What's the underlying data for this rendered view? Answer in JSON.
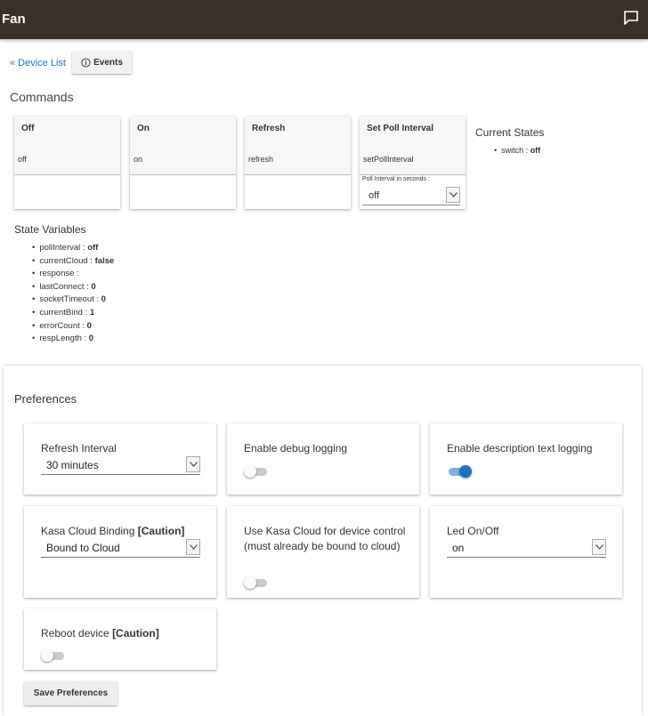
{
  "header": {
    "title": "Fan",
    "chat_icon": "chat-bubble-icon"
  },
  "nav": {
    "device_list_link": "« Device List",
    "events_button": "Events",
    "events_icon": "info-circle-icon"
  },
  "commands": {
    "title": "Commands",
    "items": [
      {
        "label": "Off",
        "method": "off"
      },
      {
        "label": "On",
        "method": "on"
      },
      {
        "label": "Refresh",
        "method": "refresh"
      },
      {
        "label": "Set Poll Interval",
        "method": "setPollInterval",
        "param_label": "Poll Interval in seconds :",
        "param_value": "off"
      }
    ]
  },
  "current_states": {
    "title": "Current States",
    "items": [
      {
        "key": "switch",
        "value": "off"
      }
    ]
  },
  "state_variables": {
    "title": "State Variables",
    "items": [
      {
        "key": "pollInterval",
        "value": "off"
      },
      {
        "key": "currentCloud",
        "value": "false"
      },
      {
        "key": "response",
        "value": ""
      },
      {
        "key": "lastConnect",
        "value": "0"
      },
      {
        "key": "socketTimeout",
        "value": "0"
      },
      {
        "key": "currentBind",
        "value": "1"
      },
      {
        "key": "errorCount",
        "value": "0"
      },
      {
        "key": "respLength",
        "value": "0"
      }
    ]
  },
  "preferences": {
    "title": "Preferences",
    "refresh_interval": {
      "label": "Refresh Interval",
      "value": "30 minutes"
    },
    "debug_logging": {
      "label": "Enable debug logging",
      "enabled": false
    },
    "desc_logging": {
      "label": "Enable description text logging",
      "enabled": true
    },
    "cloud_binding": {
      "label": "Kasa Cloud Binding ",
      "caution": "[Caution]",
      "value": "Bound to Cloud"
    },
    "use_cloud": {
      "label": "Use Kasa Cloud for device control (must already be bound to cloud)",
      "enabled": false
    },
    "led": {
      "label": "Led On/Off",
      "value": "on"
    },
    "reboot": {
      "label": "Reboot device ",
      "caution": "[Caution]",
      "enabled": false
    },
    "save_button": "Save Preferences"
  },
  "colors": {
    "header_bg": "#3b2f2a",
    "link": "#1a73c7",
    "toggle_on": "#1a73c7"
  }
}
